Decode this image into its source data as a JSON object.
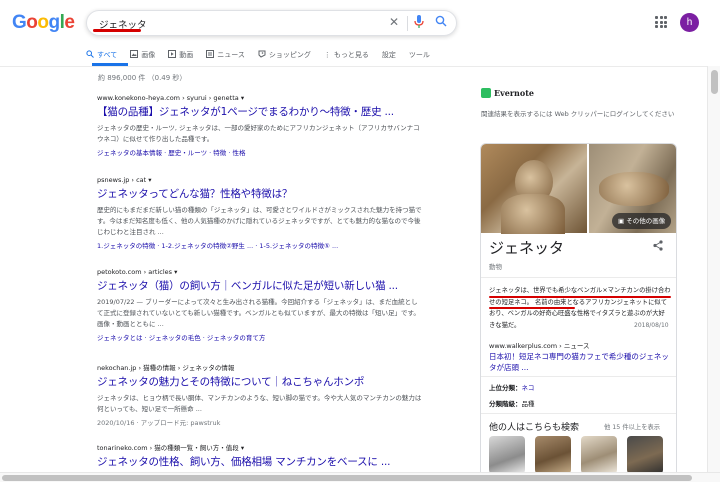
{
  "header": {
    "logo_letters": [
      "G",
      "o",
      "o",
      "g",
      "l",
      "e"
    ],
    "query": "ジェネッタ",
    "avatar_letter": "h"
  },
  "tabs": [
    {
      "icon": "search-icon",
      "label": "すべて"
    },
    {
      "icon": "image-icon",
      "label": "画像"
    },
    {
      "icon": "video-icon",
      "label": "動画"
    },
    {
      "icon": "news-icon",
      "label": "ニュース"
    },
    {
      "icon": "shopping-icon",
      "label": "ショッピング"
    },
    {
      "icon": "more-vert-icon",
      "label": "もっと見る"
    },
    {
      "icon": "",
      "label": "設定"
    },
    {
      "icon": "",
      "label": "ツール"
    }
  ],
  "stats": "約 896,000 件 （0.49 秒）",
  "results": [
    {
      "cite": "www.konekono-heya.com › syurui › genetta ▾",
      "title": "【猫の品種】ジェネッタが1ページでまるわかり〜特徴・歴史 ...",
      "snippet": "ジェネッタの歴史・ルーツ, ジェネッタは、一部の愛好家のためにアフリカンジェネット（アフリカサバンナコウネコ）に似せて作り出した品種です。",
      "sitelinks": "ジェネッタの基本情報 · 歴史・ルーツ · 特徴 · 性格"
    },
    {
      "cite": "psnews.jp › cat ▾",
      "title": "ジェネッタってどんな猫？性格や特徴は？",
      "snippet": "歴史的にもまだまだ新しい猫の種類の「ジェネッタ」は、可愛さとワイルドさがミックスされた魅力を持つ猫です。今はまだ知名度も低く、他の人気猫種のかげに隠れているジェネッタですが、とても魅力的な猫なので今後じわじわと注目され ...",
      "sitelinks": "1.ジェネッタの特徴 · 1-2.ジェネッタの特徴②野生 ... · 1-5.ジェネッタの特徴⑤ ..."
    },
    {
      "cite": "petokoto.com › articles ▾",
      "title": "ジェネッタ（猫）の飼い方｜ベンガルに似た足が短い新しい猫 ...",
      "snippet": "2019/07/22 — ブリーダーによって次々と生み出される猫種。今回紹介する「ジェネッタ」は、まだ血統として正式に登録されていないとても新しい猫種です。ベンガルとも似ていますが、最大の特徴は「短い足」です。画像・動画とともに ...",
      "sitelinks": "ジェネッタとは · ジェネッタの毛色 · ジェネッタの育て方"
    },
    {
      "cite": "nekochan.jp › 猫種の情報 › ジェネッタの情報",
      "title": "ジェネッタの魅力とその特徴について｜ねこちゃんホンポ",
      "snippet": "ジェネッタは、ヒョウ柄で長い胴体、マンチカンのような、短い脚の猫です。今や大人気のマンチカンの魅力は何といっても、短い足で一所懸命 ...",
      "sitelinks": "2020/10/16 · アップロード元: pawstruk"
    },
    {
      "cite": "tonarineko.com › 猫の種類一覧・飼い方・值段 ▾",
      "title": "ジェネッタの性格、飼い方、価格相場 マンチカンをベースに ...",
      "snippet": "",
      "sitelinks": ""
    }
  ],
  "evernote": {
    "title": "Evernote",
    "message": "関連結果を表示するには Web クリッパーにログインしてください"
  },
  "knowledge_panel": {
    "more_images_label": "その他の画像",
    "title": "ジェネッタ",
    "subtitle": "動物",
    "description": "ジェネッタは、世界でも希少なベンガル×マンチカンの掛け合わせの短足ネコ。 名前の由来となるアフリカンジェネットに似ており、ベンガルの好奇心旺盛な性格でイタズラと遊ぶのが大好きな猫だ。",
    "date": "2018/08/10",
    "source_url": "www.walkerplus.com › ニュース",
    "source_title": "日本初！短足ネコ専門の猫カフェで希少種のジェネッタが店頭 ...",
    "facts": [
      {
        "label": "上位分類：",
        "value": "ネコ"
      },
      {
        "label": "分類階級：",
        "value": "品種"
      }
    ],
    "others_heading": "他の人はこちらも検索",
    "others_more": "他 15 件以上を表示"
  }
}
